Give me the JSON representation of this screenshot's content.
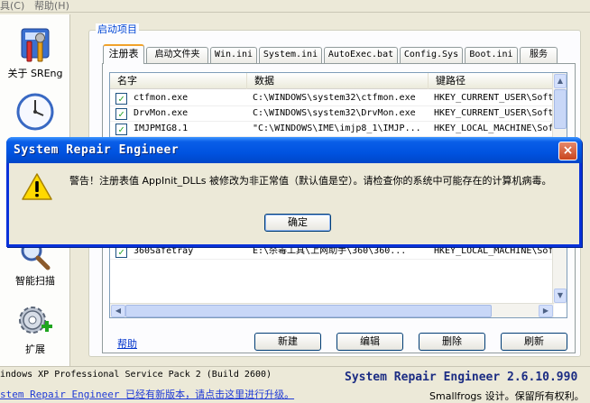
{
  "menubar": {
    "items": [
      "具(C)",
      "帮助(H)"
    ]
  },
  "nav": {
    "items": [
      {
        "label": "关于 SREng",
        "icon": "tools-icon"
      },
      {
        "label": "",
        "icon": "clock-icon"
      },
      {
        "label": "智能扫描",
        "icon": "magnifier-icon"
      },
      {
        "label": "扩展",
        "icon": "gear-plus-icon"
      }
    ]
  },
  "group_title": "启动项目",
  "tabs": [
    "注册表",
    "启动文件夹",
    "Win.ini",
    "System.ini",
    "AutoExec.bat",
    "Config.Sys",
    "Boot.ini",
    "服务"
  ],
  "list": {
    "columns": [
      "名字",
      "数据",
      "键路径"
    ],
    "rows": [
      {
        "checked": true,
        "name": "ctfmon.exe",
        "data": "C:\\WINDOWS\\system32\\ctfmon.exe",
        "path": "HKEY_CURRENT_USER\\Soft"
      },
      {
        "checked": true,
        "name": "DrvMon.exe",
        "data": "C:\\WINDOWS\\system32\\DrvMon.exe",
        "path": "HKEY_CURRENT_USER\\Soft"
      },
      {
        "checked": true,
        "name": "IMJPMIG8.1",
        "data": "\"C:\\WINDOWS\\IME\\imjp8_1\\IMJP...",
        "path": "HKEY_LOCAL_MACHINE\\Sof"
      },
      {
        "checked": true,
        "name": "360Safetray",
        "data": "E:\\杀毒工具\\上网助手\\360\\360...",
        "path": "HKEY_LOCAL_MACHINE\\Sof"
      }
    ]
  },
  "links": {
    "help": "帮助"
  },
  "buttons": {
    "new": "新建",
    "edit": "编辑",
    "delete": "删除",
    "refresh": "刷新"
  },
  "status": {
    "os": "indows XP Professional Service Pack 2 (Build 2600)",
    "update": "stem Repair Engineer 已经有新版本，请点击这里进行升级。",
    "product": "System Repair Engineer 2.6.10.990",
    "copyright": "Smallfrogs 设计。保留所有权利。"
  },
  "dialog": {
    "title": "System Repair Engineer",
    "message": "警告！注册表值 AppInit_DLLs 被修改为非正常值（默认值是空）。请检查你的系统中可能存在的计算机病毒。",
    "ok": "确定",
    "close": "×"
  },
  "colors": {
    "titlebar": "#0053e0",
    "accent_tab": "#f1a22b",
    "link": "#0033cc",
    "check": "#21a121"
  }
}
